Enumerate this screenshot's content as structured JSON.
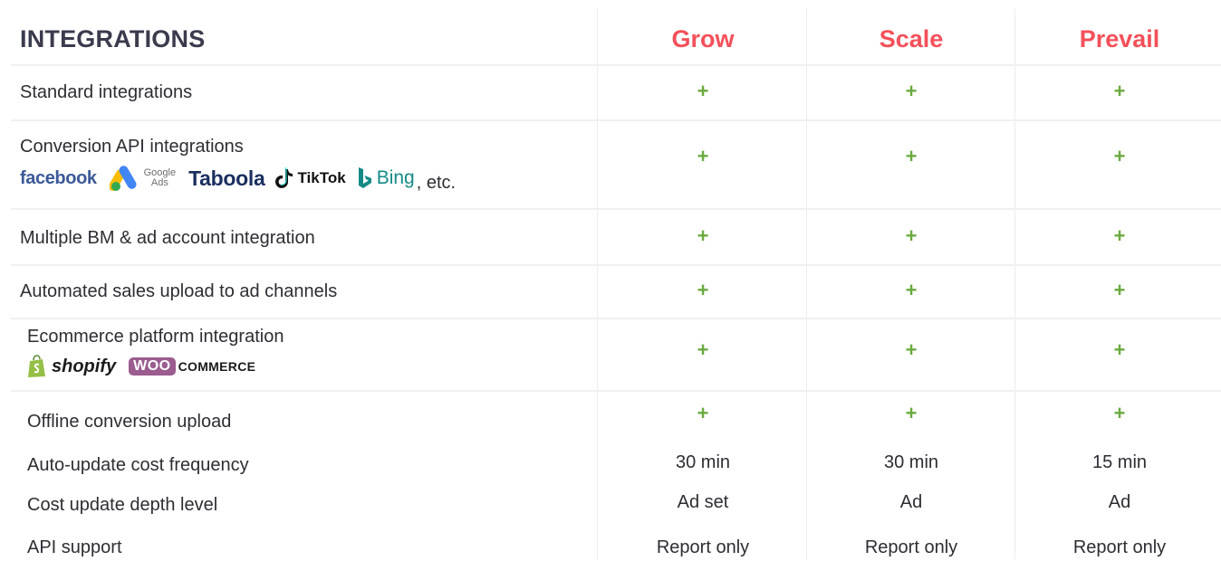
{
  "header": {
    "title": "INTEGRATIONS",
    "plans": [
      "Grow",
      "Scale",
      "Prevail"
    ]
  },
  "colors": {
    "plan": "#f4505a",
    "plus": "#6aaa3f",
    "text": "#2d2d33"
  },
  "rows": [
    {
      "feature": "Standard integrations",
      "values": [
        "+",
        "+",
        "+"
      ]
    },
    {
      "feature": "Conversion API integrations",
      "values": [
        "+",
        "+",
        "+"
      ]
    },
    {
      "feature": "Multiple BM & ad account integration",
      "values": [
        "+",
        "+",
        "+"
      ]
    },
    {
      "feature": "Automated sales upload to ad channels",
      "values": [
        "+",
        "+",
        "+"
      ]
    },
    {
      "feature": "Ecommerce platform integration",
      "values": [
        "+",
        "+",
        "+"
      ]
    },
    {
      "feature": "Offline conversion upload",
      "values": [
        "+",
        "+",
        "+"
      ]
    },
    {
      "feature": "Auto-update cost frequency",
      "values": [
        "30 min",
        "30 min",
        "15 min"
      ]
    },
    {
      "feature": "Cost update depth level",
      "values": [
        "Ad set",
        "Ad",
        "Ad"
      ]
    },
    {
      "feature": "API support",
      "values": [
        "Report only",
        "Report only",
        "Report only"
      ]
    }
  ],
  "conversion_logos": {
    "facebook": "facebook",
    "google_ads_line1": "Google",
    "google_ads_line2": "Ads",
    "taboola": "Taboola",
    "tiktok": "TikTok",
    "bing": "Bing",
    "etc": ", etc."
  },
  "ecommerce_logos": {
    "shopify": "shopify",
    "woo_badge": "WOO",
    "woo_text": "COMMERCE"
  }
}
